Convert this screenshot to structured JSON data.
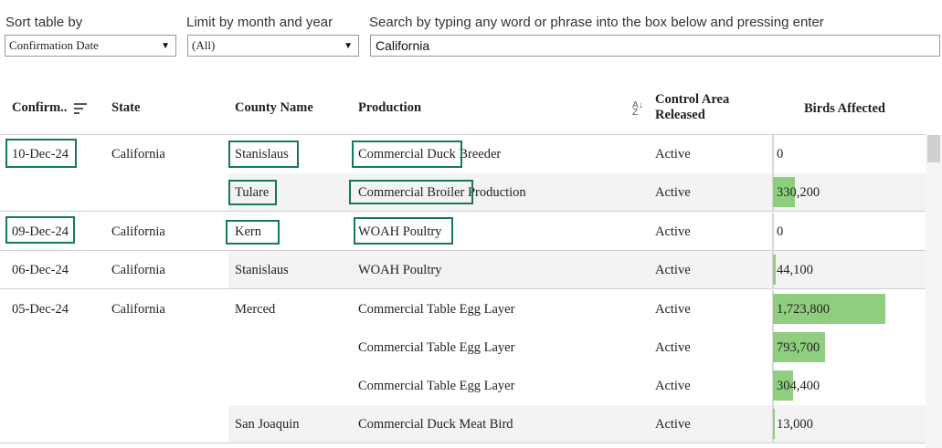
{
  "filters": {
    "sort": {
      "label": "Sort table by",
      "value": "Confirmation Date"
    },
    "month": {
      "label": "Limit by month and year",
      "value": "(All)"
    },
    "search": {
      "label": "Search by typing any word or phrase into the box below and pressing enter",
      "value": "California"
    }
  },
  "table": {
    "headers": {
      "date": "Confirm..",
      "state": "State",
      "county": "County Name",
      "production": "Production",
      "control_line1": "Control Area",
      "control_line2": "Released",
      "birds": "Birds Affected"
    },
    "rows": [
      {
        "date": "10-Dec-24",
        "state": "California",
        "county": "Stanislaus",
        "production": "Commercial Duck Breeder",
        "control": "Active",
        "birds_label": "0",
        "birds": 0
      },
      {
        "date": "",
        "state": "",
        "county": "Tulare",
        "production": "Commercial Broiler Production",
        "control": "Active",
        "birds_label": "330,200",
        "birds": 330200
      },
      {
        "date": "09-Dec-24",
        "state": "California",
        "county": "Kern",
        "production": "WOAH Poultry",
        "control": "Active",
        "birds_label": "0",
        "birds": 0
      },
      {
        "date": "06-Dec-24",
        "state": "California",
        "county": "Stanislaus",
        "production": "WOAH Poultry",
        "control": "Active",
        "birds_label": "44,100",
        "birds": 44100
      },
      {
        "date": "05-Dec-24",
        "state": "California",
        "county": "Merced",
        "production": "Commercial Table Egg Layer",
        "control": "Active",
        "birds_label": "1,723,800",
        "birds": 1723800
      },
      {
        "date": "",
        "state": "",
        "county": "",
        "production": "Commercial Table Egg Layer",
        "control": "Active",
        "birds_label": "793,700",
        "birds": 793700
      },
      {
        "date": "",
        "state": "",
        "county": "",
        "production": "Commercial Table Egg Layer",
        "control": "Active",
        "birds_label": "304,400",
        "birds": 304400
      },
      {
        "date": "",
        "state": "",
        "county": "San Joaquin",
        "production": "Commercial Duck Meat Bird",
        "control": "Active",
        "birds_label": "13,000",
        "birds": 13000
      }
    ]
  },
  "colors": {
    "bar": "#8fce7f",
    "highlight": "#137a55",
    "shade": "#f3f3f3"
  },
  "icons": {
    "sort": "sort-descending-icon",
    "az": "sort-az-icon",
    "dropdown": "chevron-down-icon"
  }
}
